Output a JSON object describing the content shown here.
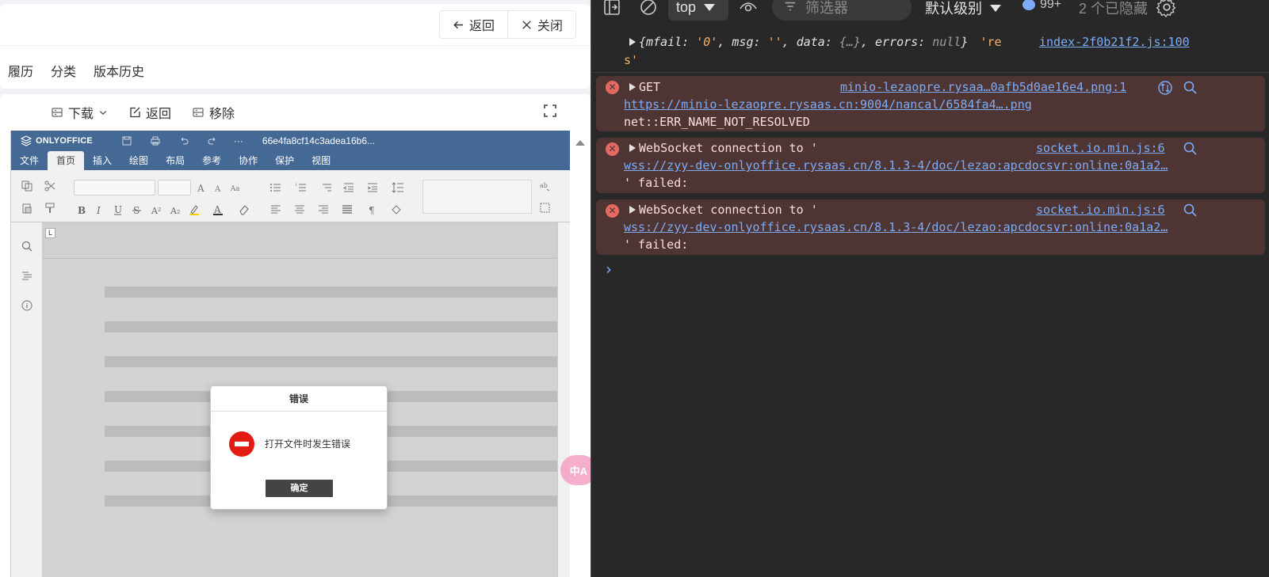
{
  "app": {
    "header": {
      "back_label": "返回",
      "close_label": "关闭",
      "tabs": [
        "履历",
        "分类",
        "版本历史"
      ]
    },
    "viewer_toolbar": {
      "download_label": "下载",
      "back_label": "返回",
      "remove_label": "移除"
    },
    "onlyoffice": {
      "brand": "ONLYOFFICE",
      "file_name": "66e4fa8cf14c3adea16b6...",
      "more": "···",
      "menu": [
        "文件",
        "首页",
        "插入",
        "绘图",
        "布局",
        "参考",
        "协作",
        "保护",
        "视图"
      ],
      "active_menu": "首页",
      "dialog": {
        "title": "错误",
        "message": "打开文件时发生错误",
        "ok_label": "确定"
      }
    },
    "translate_fab": "中A"
  },
  "devtools": {
    "context": "top",
    "filter_placeholder": "筛选器",
    "level": "默认级别",
    "message_count": "99+",
    "hidden_count": "2 个已隐藏",
    "entries": [
      {
        "type": "info",
        "obj_open": "{",
        "k1": "mfail",
        "v1": "'0'",
        "k2": "msg",
        "v2": "''",
        "k3": "data",
        "v3": "{…}",
        "k4": "errors",
        "v4": "null",
        "obj_close": "}",
        "tail": "'re",
        "tail2": "s'",
        "source": "index-2f0b21f2.js:100"
      },
      {
        "type": "error",
        "line1": "GET",
        "source": "minio-lezaopre.rysaa…0afb5d0ae16e4.png:1",
        "url": "https://minio-lezaopre.rysaas.cn:9004/nancal/6584fa4….png",
        "line3": "net::ERR_NAME_NOT_RESOLVED"
      },
      {
        "type": "error",
        "line1": "WebSocket connection to '",
        "source": "socket.io.min.js:6",
        "url": "wss://zyy-dev-onlyoffice.rysaas.cn/8.1.3-4/doc/lezao:apcdocsvr:online:0a1a2…",
        "line3": "' failed:"
      },
      {
        "type": "error",
        "line1": "WebSocket connection to '",
        "source": "socket.io.min.js:6",
        "url": "wss://zyy-dev-onlyoffice.rysaas.cn/8.1.3-4/doc/lezao:apcdocsvr:online:0a1a2…",
        "line3": "' failed:"
      }
    ]
  }
}
